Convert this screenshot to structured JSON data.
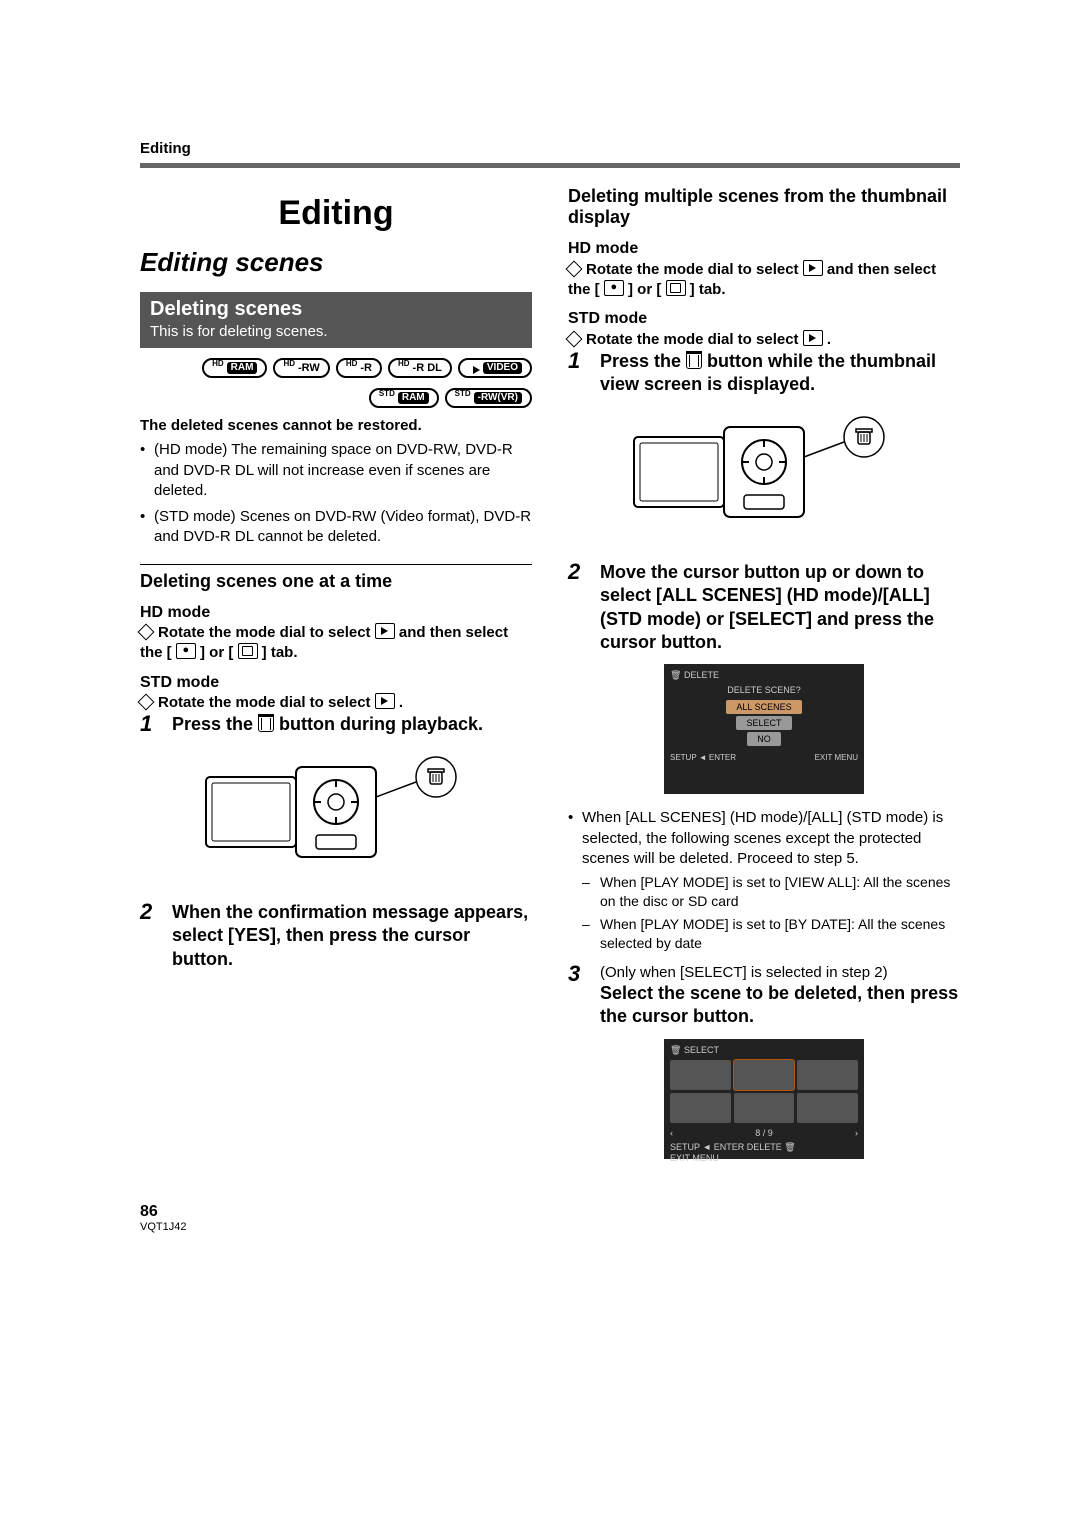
{
  "section_tag": "Editing",
  "h1": "Editing",
  "h2": "Editing scenes",
  "col1": {
    "h3": "Deleting scenes",
    "h3_sub": "This is for deleting scenes.",
    "ovals_row1": [
      {
        "sup": "HD",
        "label": "RAM"
      },
      {
        "sup": "HD",
        "label": "-RW"
      },
      {
        "sup": "HD",
        "label": "-R"
      },
      {
        "sup": "HD",
        "label": "-R DL"
      },
      {
        "sup": "",
        "label": "VIDEO",
        "play_icon": true
      }
    ],
    "ovals_row2": [
      {
        "sup": "STD",
        "label": "RAM"
      },
      {
        "sup": "STD",
        "label": "-RW(VR)"
      }
    ],
    "warn": "The deleted scenes cannot be restored.",
    "bullets": [
      "(HD mode) The remaining space on DVD-RW, DVD-R and DVD-R DL will not increase even if scenes are deleted.",
      "(STD mode) Scenes on DVD-RW (Video format), DVD-R and DVD-R DL cannot be deleted."
    ],
    "h4a": "Deleting scenes one at a time",
    "hd_mode": "HD mode",
    "hd_instr_pre": "Rotate the mode dial to select ",
    "hd_instr_mid": " and then select the [ ",
    "hd_instr_or": " ] or [ ",
    "hd_instr_end": " ] tab.",
    "std_mode": "STD mode",
    "std_instr_pre": "Rotate the mode dial to select ",
    "std_instr_end": " .",
    "step1": "Press the      button during playback.",
    "step1_pre": "Press the ",
    "step1_post": " button during playback.",
    "step2": "When the confirmation message appears, select [YES], then press the cursor button."
  },
  "col2": {
    "h4b": "Deleting multiple scenes from the thumbnail display",
    "hd_mode": "HD mode",
    "hd_instr_pre": "Rotate the mode dial to select ",
    "hd_instr_mid": " and then select the [ ",
    "hd_instr_or": " ] or [ ",
    "hd_instr_end": " ] tab.",
    "std_mode": "STD mode",
    "std_instr_pre": "Rotate the mode dial to select ",
    "std_instr_end": " .",
    "step1_pre": "Press the ",
    "step1_post": " button while the thumbnail view screen is displayed.",
    "step2": "Move the cursor button up or down to select [ALL SCENES] (HD mode)/[ALL] (STD mode) or [SELECT] and press the cursor button.",
    "lcd1": {
      "title": "DELETE",
      "question": "DELETE SCENE?",
      "opt1": "ALL SCENES",
      "opt2": "SELECT",
      "opt3": "NO",
      "foot_l": "SETUP ◄ ENTER",
      "foot_r": "EXIT MENU"
    },
    "bullets2_intro": "When [ALL SCENES] (HD mode)/[ALL] (STD mode) is selected, the following scenes except the protected scenes will be deleted. Proceed to step 5.",
    "dash": [
      "When [PLAY MODE] is set to [VIEW ALL]: All the scenes on the disc or SD card",
      "When [PLAY MODE] is set to [BY DATE]: All the scenes selected by date"
    ],
    "step3_note": "(Only when [SELECT] is selected in step 2)",
    "step3": "Select the scene to be deleted, then press the cursor button.",
    "lcd2": {
      "title": "SELECT",
      "page": "8 / 9",
      "foot_l": "SETUP ◄ ENTER",
      "foot_r_del": "DELETE",
      "foot_r_exit": "EXIT MENU"
    }
  },
  "footer": {
    "page": "86",
    "code": "VQT1J42"
  }
}
